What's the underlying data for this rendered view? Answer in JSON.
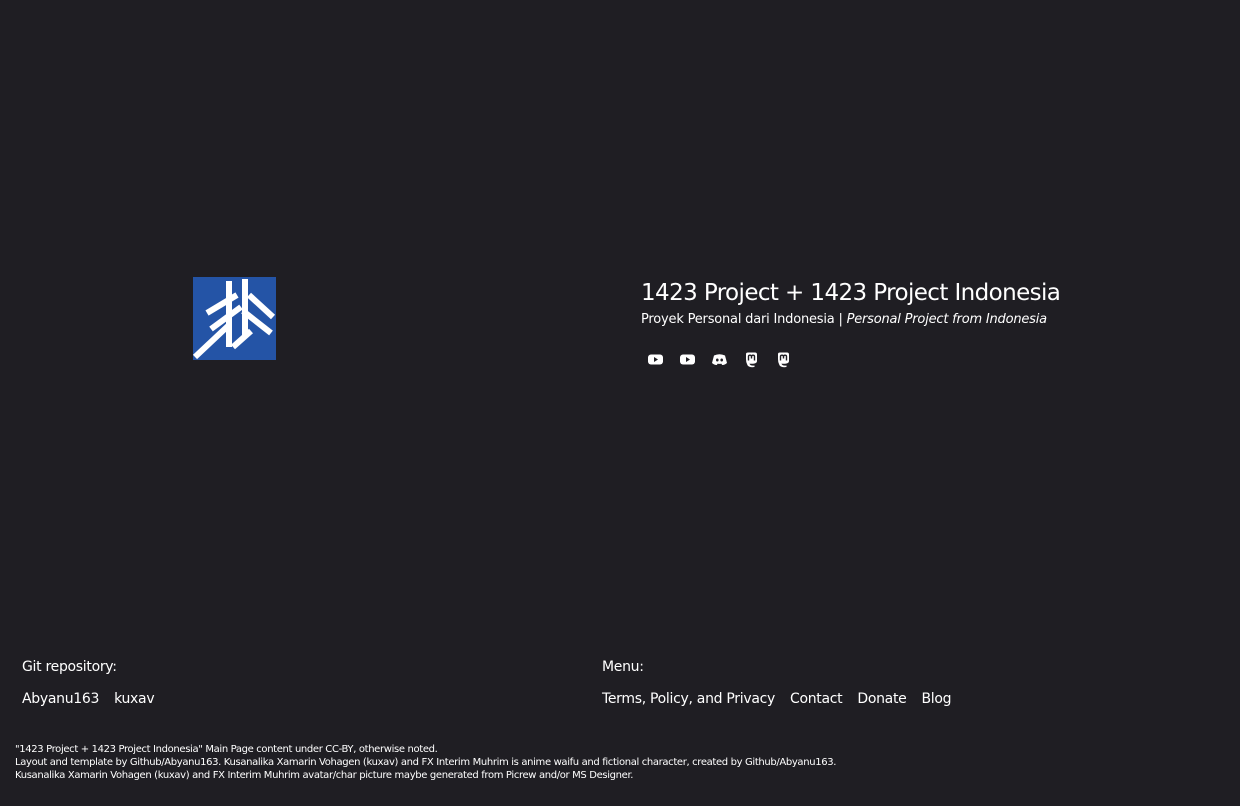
{
  "brand": {
    "logo_icon": "1423-project-logo",
    "logo_color": "#2454a6",
    "background": "#1f1e23"
  },
  "hero": {
    "title": "1423 Project + 1423 Project Indonesia",
    "subtitle_main": "Proyek Personal dari Indonesia | ",
    "subtitle_italic": "Personal Project from Indonesia"
  },
  "socials": [
    {
      "icon": "youtube-icon"
    },
    {
      "icon": "youtube-icon"
    },
    {
      "icon": "discord-icon"
    },
    {
      "icon": "mastodon-icon"
    },
    {
      "icon": "mastodon-icon"
    }
  ],
  "footer": {
    "git": {
      "heading": "Git repository:",
      "links": [
        "Abyanu163",
        "kuxav"
      ]
    },
    "menu": {
      "heading": "Menu:",
      "links": [
        "Terms, Policy, and Privacy",
        "Contact",
        "Donate",
        "Blog"
      ]
    },
    "notice": [
      "\"1423 Project + 1423 Project Indonesia\" Main Page content under CC-BY, otherwise noted.",
      "Layout and template by Github/Abyanu163. Kusanalika Xamarin Vohagen (kuxav) and FX Interim Muhrim is anime waifu and fictional character, created by Github/Abyanu163.",
      "Kusanalika Xamarin Vohagen (kuxav) and FX Interim Muhrim avatar/char picture maybe generated from Picrew and/or MS Designer."
    ]
  }
}
